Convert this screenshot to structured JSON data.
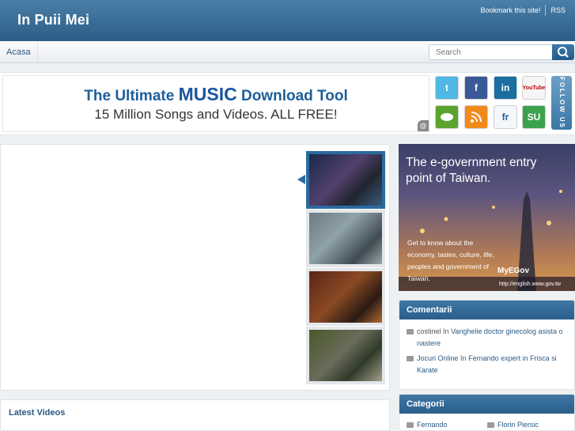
{
  "site": {
    "title": "In Puii Mei"
  },
  "top_links": {
    "bookmark": "Bookmark this site!",
    "rss": "RSS"
  },
  "nav": {
    "items": [
      {
        "label": "Acasa"
      }
    ]
  },
  "search": {
    "placeholder": "Search"
  },
  "banner_ad": {
    "line1_prefix": "The Ultimate ",
    "line1_emphasis": "MUSIC",
    "line1_suffix": " Download Tool",
    "line2": "15 Million Songs and Videos. ALL FREE!"
  },
  "social": {
    "icons": [
      "twitter-icon",
      "facebook-icon",
      "linkedin-icon",
      "youtube-icon",
      "googletalk-icon",
      "rss-feed-icon",
      "friendfeed-icon",
      "stumbleupon-icon"
    ],
    "follow_label": "FOLLOW US",
    "youtube_label": "YouTube",
    "friendfeed_label": "fr",
    "stumbleupon_label": "SU"
  },
  "latest_videos": {
    "title": "Latest Videos"
  },
  "side_ad": {
    "headline": "The e-government entry point of Taiwan.",
    "body": "Get to know about the economy, tastes, culture, life, peoples and government of Taiwan.",
    "logo": "MyEGov",
    "url": "http://english.www.gov.tw"
  },
  "comments_widget": {
    "title": "Comentarii",
    "items": [
      {
        "author": "costinel",
        "in": "în",
        "post": "Vanghelie doctor ginecolog asista o nastere"
      },
      {
        "author": "Jocuri Online",
        "in": "în",
        "post": "Fernando expert in Frisca si Karate"
      }
    ]
  },
  "categories_widget": {
    "title": "Categorii",
    "items": [
      {
        "label": "Fernando"
      },
      {
        "label": "Florin Piersic"
      }
    ]
  },
  "colors": {
    "header": "#2c5d86",
    "accent": "#2a5b84",
    "widget_head": "#3f77a4"
  }
}
